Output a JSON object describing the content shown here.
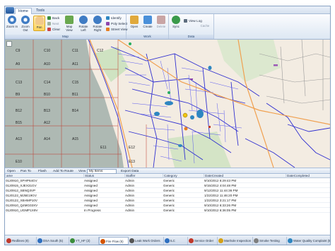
{
  "tabs": {
    "home": "Home",
    "tools": "Tools"
  },
  "ribbon": {
    "zoom_in": "Zoom In",
    "zoom_out": "Zoom Out",
    "pan": "Pan",
    "back": "Back",
    "next": "Next",
    "clear": "Clear",
    "map_view": "Map View",
    "rotate_left": "Rotate Left",
    "rotate_right": "Rotate Right",
    "identify": "Identify",
    "poly_select": "Poly Select",
    "street_view": "Street View",
    "open": "Open",
    "create": "Create",
    "delete": "Delete",
    "sync": "Sync",
    "view_log": "View Log",
    "cache": "Cache",
    "group_map": "Map",
    "group_work": "Work",
    "group_data": "Data"
  },
  "grid_labels": {
    "row1": [
      "C9",
      "C10",
      "C11",
      "C12"
    ],
    "row2": [
      "A9",
      "A10",
      "A11"
    ],
    "misc": [
      "C13",
      "C14",
      "C15",
      "B9",
      "B10",
      "B11",
      "B12",
      "B13",
      "B14",
      "B15",
      "A12",
      "A13",
      "A14",
      "A15",
      "E10",
      "E11",
      "E12",
      "E13"
    ]
  },
  "map_toolbar": {
    "open": "Open",
    "pan_to": "Pan To",
    "flash": "Flash",
    "add_to_route": "Add To Route",
    "view": "View",
    "view_value": "My Items",
    "export": "Export Data"
  },
  "table": {
    "columns": [
      "ame",
      "Status",
      "Staffer",
      "Category",
      "DateCreated",
      "DateCompleted"
    ],
    "rows": [
      [
        "0120910_SPHP64GV",
        "Assigned",
        "Admin",
        "Generic",
        "9/10/2012 6:29:43 PM",
        ""
      ],
      [
        "0120915_XJEX31GV",
        "Assigned",
        "Admin",
        "Generic",
        "9/15/2012 4:04:48 PM",
        ""
      ],
      [
        "0120912_SBNQ3VP",
        "Assigned",
        "Admin",
        "Generic",
        "9/12/2012 11:44:36 PM",
        ""
      ],
      [
        "0120122_MJ5E19GV",
        "Assigned",
        "Admin",
        "Generic",
        "1/22/2012 11:46:20 PM",
        ""
      ],
      [
        "0120122_XBHMP10V",
        "Assigned",
        "Admin",
        "Generic",
        "1/22/2012 3:21:17 PM",
        ""
      ],
      [
        "0120910_Q4MG03XV",
        "Assigned",
        "Admin",
        "Generic",
        "9/10/2012 6:33:26 PM",
        ""
      ],
      [
        "0120910_UGMP1X9V",
        "In Progress",
        "Admin",
        "Generic",
        "9/10/2012 6:36:05 PM",
        ""
      ]
    ]
  },
  "status_tabs": [
    {
      "label": "Redlines (8)",
      "color": "#c0392b"
    },
    {
      "label": "DSA South (5)",
      "color": "#2e6fc0"
    },
    {
      "label": "YT_HF (2)",
      "color": "#3b8d3b"
    },
    {
      "label": "Fire Flow (5)",
      "color": "#d35400"
    },
    {
      "label": "Leak Work Orders",
      "color": "#555555"
    },
    {
      "label": "ILC",
      "color": "#2e6fc0"
    },
    {
      "label": "Service Order",
      "color": "#c0392b"
    },
    {
      "label": "Manhole Inspection",
      "color": "#d4a017"
    },
    {
      "label": "Smoke Testing",
      "color": "#7f7f7f"
    },
    {
      "label": "Water Quality Complaint (5)",
      "color": "#2e86c1"
    }
  ]
}
